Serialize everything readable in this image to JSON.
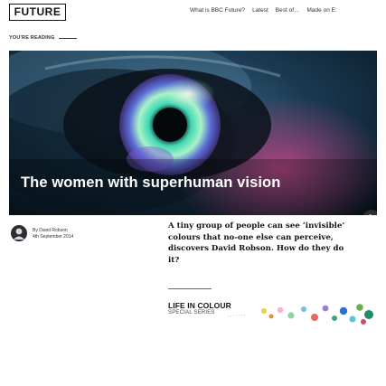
{
  "header": {
    "brand": "FUTURE",
    "nav": [
      "What is BBC Future?",
      "Latest",
      "Best of…",
      "Made on E:"
    ]
  },
  "reading": {
    "label": "YOU'RE READING"
  },
  "hero": {
    "title": "The women with superhuman vision",
    "image": "close-up of an iridescent human eye"
  },
  "article": {
    "author": "By David Robson",
    "date": "4th September 2014",
    "summary": "A tiny group of people can see ‘invisible’ colours that no-one else can perceive, discovers David Robson. How do they do it?"
  },
  "series": {
    "title": "LIFE IN COLOUR",
    "subtitle": "SPECIAL SERIES"
  },
  "colors": {
    "accent_dark": "#2b2e33",
    "iris_glow": "#6fe3c0",
    "text": "#141414"
  }
}
